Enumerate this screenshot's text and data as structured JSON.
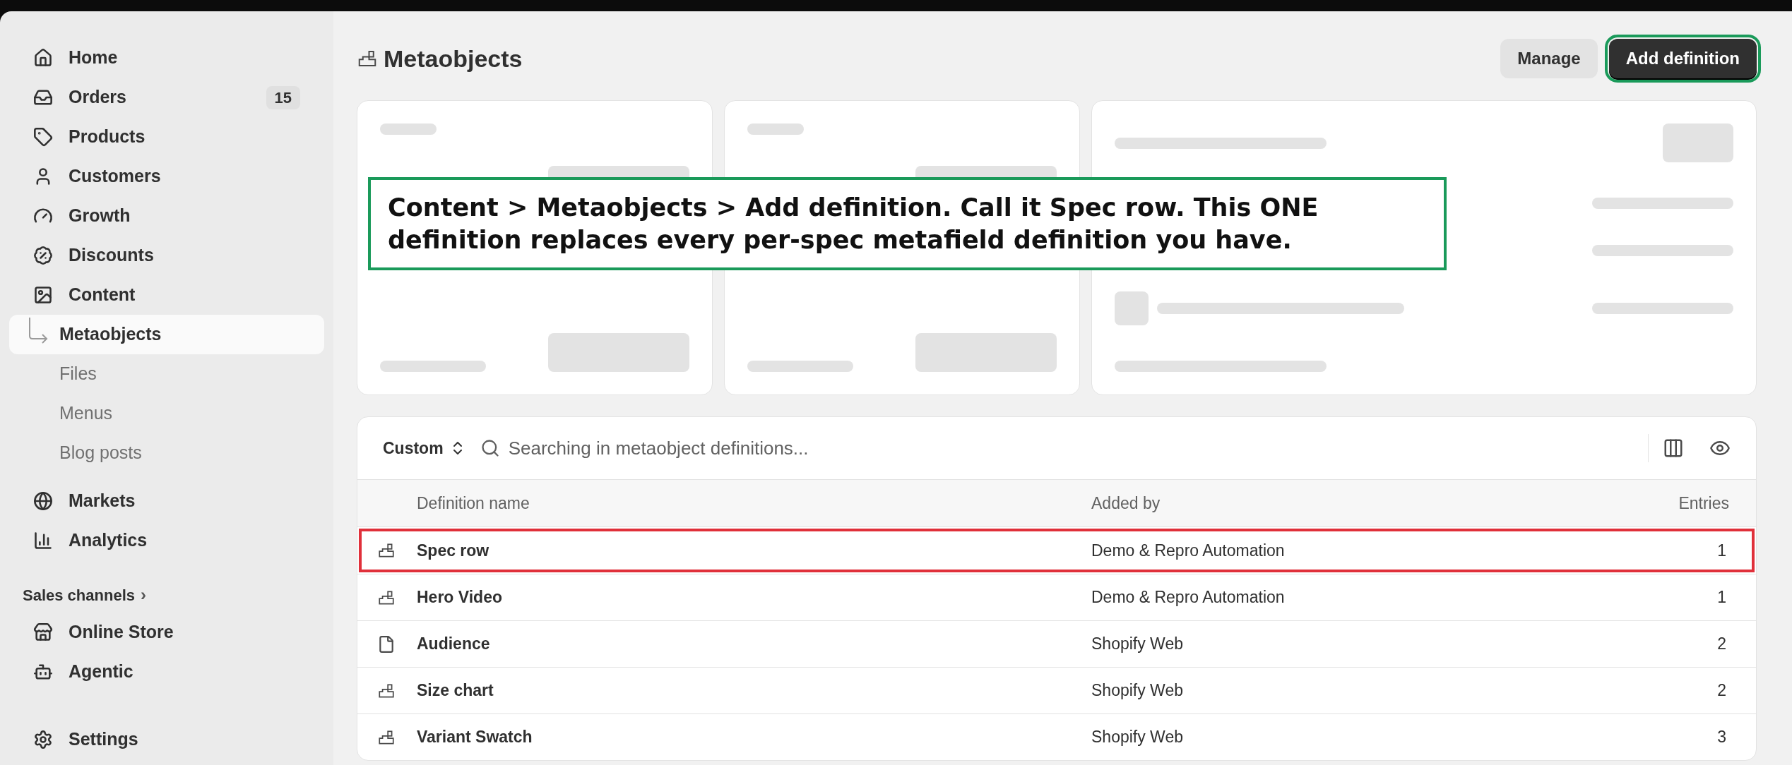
{
  "sidebar": {
    "items": [
      {
        "label": "Home",
        "kind": "home",
        "selected": false
      },
      {
        "label": "Orders",
        "kind": "orders",
        "badge": "15",
        "selected": false
      },
      {
        "label": "Products",
        "kind": "products",
        "selected": false
      },
      {
        "label": "Customers",
        "kind": "customers",
        "selected": false
      },
      {
        "label": "Growth",
        "kind": "growth",
        "selected": false
      },
      {
        "label": "Discounts",
        "kind": "discounts",
        "selected": false
      },
      {
        "label": "Content",
        "kind": "content",
        "selected": false,
        "children": [
          {
            "label": "Metaobjects",
            "selected": true
          },
          {
            "label": "Files",
            "selected": false
          },
          {
            "label": "Menus",
            "selected": false
          },
          {
            "label": "Blog posts",
            "selected": false
          }
        ]
      },
      {
        "label": "Markets",
        "kind": "markets",
        "selected": false
      },
      {
        "label": "Analytics",
        "kind": "analytics",
        "selected": false
      }
    ],
    "section": "Sales channels",
    "section_arrow": "›",
    "channels": [
      {
        "label": "Online Store",
        "kind": "store",
        "selected": false
      },
      {
        "label": "Agentic",
        "kind": "agentic",
        "selected": false
      }
    ],
    "settings": {
      "label": "Settings"
    }
  },
  "page": {
    "title": "Metaobjects",
    "buttons": [
      {
        "label": "Manage",
        "kind": "secondary",
        "highlighted": false
      },
      {
        "label": "Add definition",
        "kind": "primary",
        "highlighted": true
      }
    ]
  },
  "annotation": "Content > Metaobjects > Add definition. Call it Spec row. This ONE definition replaces every per-spec metafield definition you have.",
  "table": {
    "filter": "Custom",
    "search": {
      "placeholder": "Searching in metaobject definitions..."
    },
    "columns": [
      "Definition name",
      "Added by",
      "Entries"
    ],
    "rows": [
      {
        "kind": "metaobject",
        "name": "Spec row",
        "added_by": "Demo & Repro Automation",
        "entries": "1",
        "highlighted": true
      },
      {
        "kind": "metaobject",
        "name": "Hero Video",
        "added_by": "Demo & Repro Automation",
        "entries": "1",
        "highlighted": false
      },
      {
        "kind": "file",
        "name": "Audience",
        "added_by": "Shopify Web",
        "entries": "2",
        "highlighted": false
      },
      {
        "kind": "metaobject",
        "name": "Size chart",
        "added_by": "Shopify Web",
        "entries": "2",
        "highlighted": false
      },
      {
        "kind": "metaobject",
        "name": "Variant Swatch",
        "added_by": "Shopify Web",
        "entries": "3",
        "highlighted": false
      }
    ]
  }
}
